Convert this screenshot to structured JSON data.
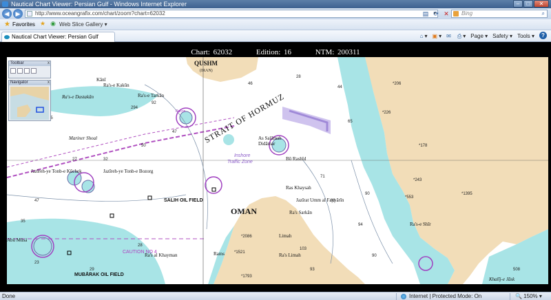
{
  "window": {
    "title": "Nautical Chart Viewer: Persian Gulf - Windows Internet Explorer",
    "min": "–",
    "max": "□",
    "close": "✕"
  },
  "nav": {
    "back": "◀",
    "forward": "▶"
  },
  "address": {
    "url": "http://www.oceangrafix.com/chart/zoom?chart=62032",
    "dropdown": "▾"
  },
  "search": {
    "placeholder": "Bing",
    "icon": "⌕"
  },
  "favorites": {
    "label": "Favorites",
    "web_slice": "Web Slice Gallery ▾"
  },
  "tab": {
    "label": "Nautical Chart Viewer: Persian Gulf"
  },
  "commands": {
    "page": "Page ▾",
    "safety": "Safety ▾",
    "tools": "Tools ▾",
    "help": "?"
  },
  "chart": {
    "chart": "Chart: 62032",
    "edition": "Edition: 16",
    "ntm": "NTM: 200311"
  },
  "panels": {
    "toolbar": "Toolbar",
    "navigator": "Navigator",
    "close": "x"
  },
  "map_labels": {
    "qushm": "QUSHM",
    "iran": "(IRAN)",
    "strait": "STRAIT OF HORMUZ",
    "oman": "OMAN",
    "salih": "SALIH OIL FIELD",
    "mubarak": "MUBĀRAK OIL FIELD",
    "caution": "CAUTION NO 4",
    "mariner": "Mariner Shoal",
    "inshore": "Inshore",
    "traffic_zone": "Traffic Zone",
    "as_salamah": "As Salāmah",
    "didamar": "Didāmar",
    "bu_rashid": "Bū Rashīd",
    "ras_khaysah": "Ras Khaysah",
    "jazirat_umm": "Jazīrat Umm al Fayyārīn",
    "ras_sarkan": "Ra's Sarkān",
    "ras_limah": "Ra's Limah",
    "limah": "Limah",
    "ras_al_khayman": "Ra's al Khayman",
    "rams": "Rams",
    "ras_e_shir": "Ra's-e Shīr",
    "khalij_jask": "Khalīj-e Jāsk",
    "tunb_kuchek": "Jazīreh-ye Tonb-e Kūchek",
    "tunb_bozorg": "Jazīreh-ye Tonb-e Bozorg",
    "abu_musa": "Abū Mūsá",
    "kani": "Kānī",
    "ras_kakun": "Ra's-e Kakūn",
    "ras_tarkan": "Ra's-e Tarkān",
    "dastakan": "Ra's-e Dastakān",
    "racon": "Racon"
  },
  "status": {
    "done": "Done",
    "zone": "Internet | Protected Mode: On",
    "zoom": "🔍 150% ▾"
  }
}
